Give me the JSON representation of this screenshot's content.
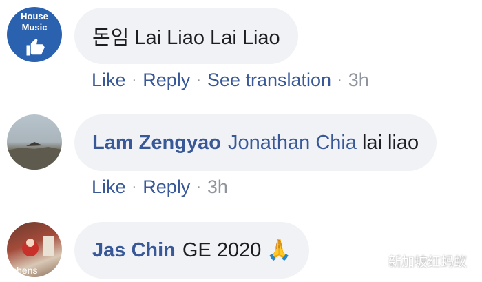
{
  "comments": [
    {
      "avatar_text": [
        "House",
        "Music"
      ],
      "segments": [
        {
          "text": "돈임 Lai Liao Lai Liao"
        }
      ],
      "actions": {
        "like": "Like",
        "reply": "Reply",
        "translate": "See translation",
        "time": "3h"
      }
    },
    {
      "author": "Lam Zengyao",
      "mention": "Jonathan Chia",
      "text": "lai liao",
      "actions": {
        "like": "Like",
        "reply": "Reply",
        "time": "3h"
      }
    },
    {
      "author": "Jas Chin",
      "text": "GE 2020",
      "emoji": "🙏",
      "avatar_caption": "ichens"
    }
  ],
  "separator": "·",
  "watermark": {
    "text": "新加坡红蚂蚁",
    "icon": "wechat-icon"
  },
  "colors": {
    "link": "#385898",
    "bubble": "#f0f2f5",
    "meta": "#90949c",
    "avatar1": "#2b62b0"
  }
}
